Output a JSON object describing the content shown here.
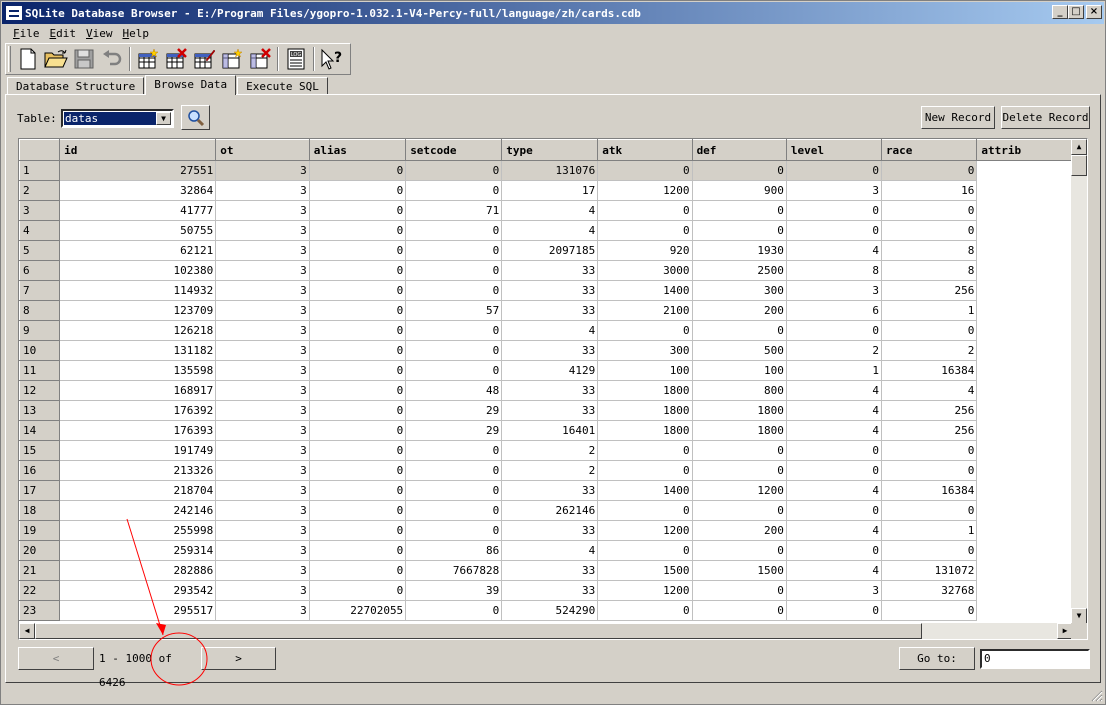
{
  "window": {
    "title": "SQLite Database Browser - E:/Program Files/ygopro-1.032.1-V4-Percy-full/language/zh/cards.cdb",
    "minimize": "_",
    "maximize": "□",
    "close": "×"
  },
  "menu": {
    "file": {
      "acc": "F",
      "rest": "ile"
    },
    "edit": {
      "acc": "E",
      "rest": "dit"
    },
    "view": {
      "acc": "V",
      "rest": "iew"
    },
    "help": {
      "acc": "H",
      "rest": "elp"
    }
  },
  "toolbar_icons": [
    "new-database-icon",
    "open-folder-icon",
    "save-disk-icon",
    "undo-icon",
    "create-table-icon",
    "delete-table-icon",
    "modify-table-icon",
    "create-index-icon",
    "delete-index-icon",
    "log-icon",
    "whats-this-icon"
  ],
  "tabs": {
    "structure": "Database Structure",
    "browse": "Browse Data",
    "sql": "Execute SQL"
  },
  "browse": {
    "table_label": "Table:",
    "table_value": "datas",
    "new_record": "New Record",
    "delete_record": "Delete Record"
  },
  "columns": [
    "id",
    "ot",
    "alias",
    "setcode",
    "type",
    "atk",
    "def",
    "level",
    "race",
    "attrib"
  ],
  "rows": [
    [
      "1",
      "27551",
      "3",
      "0",
      "0",
      "131076",
      "0",
      "0",
      "0",
      "0"
    ],
    [
      "2",
      "32864",
      "3",
      "0",
      "0",
      "17",
      "1200",
      "900",
      "3",
      "16"
    ],
    [
      "3",
      "41777",
      "3",
      "0",
      "71",
      "4",
      "0",
      "0",
      "0",
      "0"
    ],
    [
      "4",
      "50755",
      "3",
      "0",
      "0",
      "4",
      "0",
      "0",
      "0",
      "0"
    ],
    [
      "5",
      "62121",
      "3",
      "0",
      "0",
      "2097185",
      "920",
      "1930",
      "4",
      "8"
    ],
    [
      "6",
      "102380",
      "3",
      "0",
      "0",
      "33",
      "3000",
      "2500",
      "8",
      "8"
    ],
    [
      "7",
      "114932",
      "3",
      "0",
      "0",
      "33",
      "1400",
      "300",
      "3",
      "256"
    ],
    [
      "8",
      "123709",
      "3",
      "0",
      "57",
      "33",
      "2100",
      "200",
      "6",
      "1"
    ],
    [
      "9",
      "126218",
      "3",
      "0",
      "0",
      "4",
      "0",
      "0",
      "0",
      "0"
    ],
    [
      "10",
      "131182",
      "3",
      "0",
      "0",
      "33",
      "300",
      "500",
      "2",
      "2"
    ],
    [
      "11",
      "135598",
      "3",
      "0",
      "0",
      "4129",
      "100",
      "100",
      "1",
      "16384"
    ],
    [
      "12",
      "168917",
      "3",
      "0",
      "48",
      "33",
      "1800",
      "800",
      "4",
      "4"
    ],
    [
      "13",
      "176392",
      "3",
      "0",
      "29",
      "33",
      "1800",
      "1800",
      "4",
      "256"
    ],
    [
      "14",
      "176393",
      "3",
      "0",
      "29",
      "16401",
      "1800",
      "1800",
      "4",
      "256"
    ],
    [
      "15",
      "191749",
      "3",
      "0",
      "0",
      "2",
      "0",
      "0",
      "0",
      "0"
    ],
    [
      "16",
      "213326",
      "3",
      "0",
      "0",
      "2",
      "0",
      "0",
      "0",
      "0"
    ],
    [
      "17",
      "218704",
      "3",
      "0",
      "0",
      "33",
      "1400",
      "1200",
      "4",
      "16384"
    ],
    [
      "18",
      "242146",
      "3",
      "0",
      "0",
      "262146",
      "0",
      "0",
      "0",
      "0"
    ],
    [
      "19",
      "255998",
      "3",
      "0",
      "0",
      "33",
      "1200",
      "200",
      "4",
      "1"
    ],
    [
      "20",
      "259314",
      "3",
      "0",
      "86",
      "4",
      "0",
      "0",
      "0",
      "0"
    ],
    [
      "21",
      "282886",
      "3",
      "0",
      "7667828",
      "33",
      "1500",
      "1500",
      "4",
      "131072"
    ],
    [
      "22",
      "293542",
      "3",
      "0",
      "39",
      "33",
      "1200",
      "0",
      "3",
      "32768"
    ],
    [
      "23",
      "295517",
      "3",
      "22702055",
      "0",
      "524290",
      "0",
      "0",
      "0",
      "0"
    ]
  ],
  "pager": {
    "prev": "<",
    "range": "1 - 1000 of 6426",
    "next": ">",
    "goto_label": "Go to:",
    "goto_value": "0"
  },
  "annotation_color": "#ff0000"
}
